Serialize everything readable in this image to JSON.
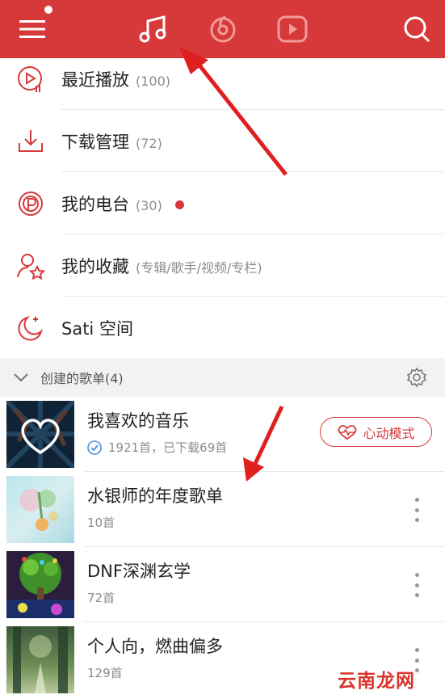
{
  "header": {
    "menu_icon": "hamburger-menu-icon",
    "tabs": [
      {
        "icon": "music-note-icon",
        "active": true
      },
      {
        "icon": "netease-cloud-icon",
        "active": false
      },
      {
        "icon": "video-play-icon",
        "active": false
      }
    ],
    "search_icon": "search-icon",
    "accent_color": "#d7393a"
  },
  "menu": {
    "items": [
      {
        "icon": "recent-play-icon",
        "label": "最近播放",
        "count": "(100)"
      },
      {
        "icon": "download-icon",
        "label": "下载管理",
        "count": "(72)"
      },
      {
        "icon": "radio-icon",
        "label": "我的电台",
        "count": "(30)"
      },
      {
        "icon": "collection-star-icon",
        "label": "我的收藏",
        "count": "(专辑/歌手/视频/专栏)"
      },
      {
        "icon": "moon-sleep-icon",
        "label": "Sati 空间",
        "count": ""
      }
    ]
  },
  "section": {
    "title": "创建的歌单(4)"
  },
  "playlists": [
    {
      "name": "我喜欢的音乐",
      "sub": "1921首，已下载69首",
      "action": "心动模式"
    },
    {
      "name": "水银师的年度歌单",
      "sub": "10首"
    },
    {
      "name": "DNF深渊玄学",
      "sub": "72首"
    },
    {
      "name": "个人向，燃曲偏多",
      "sub": "129首"
    }
  ],
  "watermark": "云南龙网"
}
